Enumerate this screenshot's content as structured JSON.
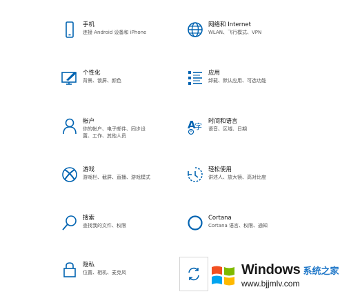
{
  "settings": [
    {
      "title": "手机",
      "sub": "连接 Android 设备和 iPhone",
      "sub2": ""
    },
    {
      "title": "网络和 Internet",
      "sub": "WLAN、飞行模式、VPN",
      "sub2": ""
    },
    {
      "title": "个性化",
      "sub": "背景、锁屏、颜色",
      "sub2": ""
    },
    {
      "title": "应用",
      "sub": "卸载、默认应用、可选功能",
      "sub2": ""
    },
    {
      "title": "帐户",
      "sub": "你的帐户、电子邮件、同步设",
      "sub2": "置、工作、其他人员"
    },
    {
      "title": "时间和语言",
      "sub": "语音、区域、日期",
      "sub2": ""
    },
    {
      "title": "游戏",
      "sub": "游戏栏、截屏、直播、游戏模式",
      "sub2": ""
    },
    {
      "title": "轻松使用",
      "sub": "讲述人、放大镜、高对比度",
      "sub2": ""
    },
    {
      "title": "搜索",
      "sub": "查找我的文件、权限",
      "sub2": ""
    },
    {
      "title": "Cortana",
      "sub": "Cortana 语言、权限、通知",
      "sub2": ""
    },
    {
      "title": "隐私",
      "sub": "位置、相机、麦克风",
      "sub2": ""
    }
  ],
  "icons": {
    "phone": "phone-icon",
    "network": "globe-icon",
    "personalization": "paint-screen-icon",
    "apps": "apps-list-icon",
    "accounts": "person-icon",
    "time_language": "time-language-icon",
    "gaming": "xbox-icon",
    "ease": "ease-of-access-icon",
    "search": "search-icon",
    "cortana": "cortana-circle-icon",
    "privacy": "lock-icon",
    "sync": "sync-icon"
  },
  "colors": {
    "accent": "#0063b1",
    "title": "#111111",
    "subtitle": "#555555"
  },
  "watermark": {
    "brand": "Windows",
    "cn": "系统之家",
    "url": "www.bjjmlv.com"
  }
}
